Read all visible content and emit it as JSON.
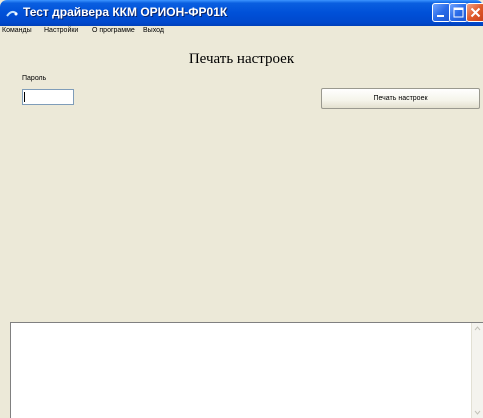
{
  "window": {
    "title": "Тест драйвера ККМ ОРИОН-ФР01К"
  },
  "menu": {
    "items": [
      {
        "label": "Команды"
      },
      {
        "label": "Настройки"
      },
      {
        "label": "О программе"
      },
      {
        "label": "Выход"
      }
    ]
  },
  "main": {
    "heading": "Печать настроек",
    "password_label": "Пароль",
    "password_value": "",
    "print_button_label": "Печать настроек"
  },
  "output": {
    "text": ""
  },
  "icons": {
    "app": "app-icon",
    "minimize": "minimize-icon",
    "maximize": "maximize-icon",
    "close": "close-icon",
    "scroll_up": "scroll-up-arrow-icon",
    "scroll_down": "scroll-down-arrow-icon"
  },
  "colors": {
    "titlebar": "#0050d8",
    "face": "#ece9d8",
    "close_button": "#e05a2a"
  }
}
